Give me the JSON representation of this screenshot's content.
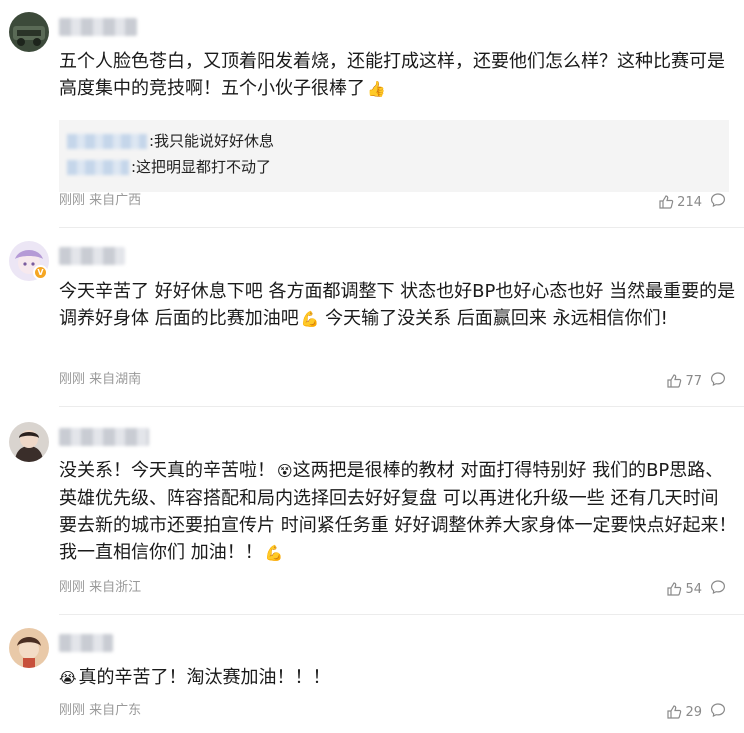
{
  "comments": [
    {
      "text": "五个人脸色苍白，又顶着阳发着烧，还能打成这样，还要他们怎么样？这种比赛可是高度集中的竞技啊！五个小伙子很棒了",
      "emoji": "👍",
      "replies": [
        {
          "text": ":我只能说好好休息"
        },
        {
          "text": ":这把明显都打不动了"
        }
      ],
      "time": "刚刚",
      "location": "来自广西",
      "likes": "214"
    },
    {
      "text": "今天辛苦了 好好休息下吧 各方面都调整下 状态也好BP也好心态也好 当然最重要的是调养好身体 后面的比赛加油吧",
      "emoji_mid": "💪",
      "text_after": " 今天输了没关系 后面赢回来 永远相信你们!",
      "time": "刚刚",
      "location": "来自湖南",
      "likes": "77"
    },
    {
      "text_before": "没关系！今天真的辛苦啦！",
      "emoji_mid": "😵",
      "text": "这两把是很棒的教材 对面打得特别好 我们的BP思路、英雄优先级、阵容搭配和局内选择回去好好复盘 可以再进化升级一些 还有几天时间 要去新的城市还要拍宣传片 时间紧任务重 好好调整休养大家身体一定要快点好起来！我一直相信你们 加油！！",
      "emoji": "💪",
      "time": "刚刚",
      "location": "来自浙江",
      "likes": "54"
    },
    {
      "emoji_before": "😭",
      "text": "真的辛苦了！淘汰赛加油！！！",
      "time": "刚刚",
      "location": "来自广东",
      "likes": "29"
    }
  ],
  "icons": {
    "like": "thumbs-up-icon",
    "comment": "comment-bubble-icon",
    "verified": "verified-badge-icon"
  },
  "colors": {
    "text": "#1a1a1a",
    "meta": "#9a9a9a",
    "quote_bg": "#f4f4f4",
    "badge": "#f5a623"
  }
}
